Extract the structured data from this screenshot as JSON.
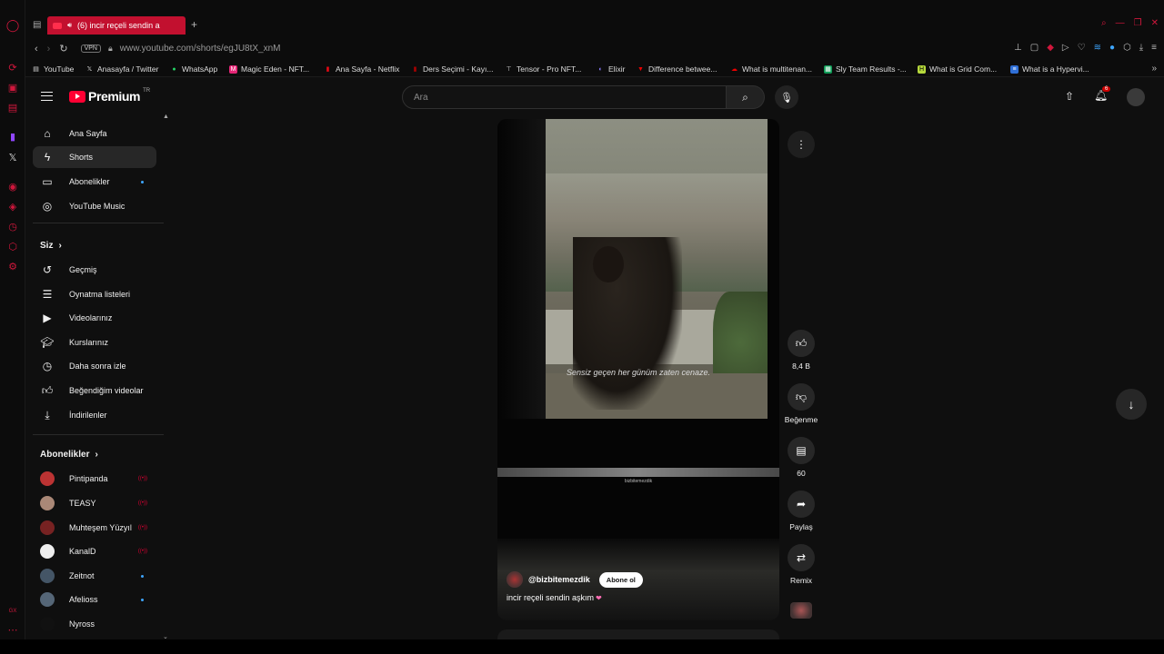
{
  "browser": {
    "tab_title": "(6) incir reçeli sendin a",
    "url": "www.youtube.com/shorts/egJU8tX_xnM",
    "vpn_label": "VPN",
    "bookmarks": [
      {
        "label": "YouTube",
        "icon": "page-icon"
      },
      {
        "label": "Anasayfa / Twitter",
        "icon": "x-icon"
      },
      {
        "label": "WhatsApp",
        "icon": "whatsapp-icon"
      },
      {
        "label": "Magic Eden - NFT...",
        "icon": "magic-eden-icon"
      },
      {
        "label": "Ana Sayfa - Netflix",
        "icon": "netflix-icon"
      },
      {
        "label": "Ders Seçimi - Kayı...",
        "icon": "school-icon"
      },
      {
        "label": "Tensor - Pro NFT...",
        "icon": "tensor-icon"
      },
      {
        "label": "Elixir",
        "icon": "elixir-icon"
      },
      {
        "label": "Difference betwee...",
        "icon": "vee-icon"
      },
      {
        "label": "What is multitenan...",
        "icon": "cloud-icon"
      },
      {
        "label": "Sly Team Results -...",
        "icon": "sheets-icon"
      },
      {
        "label": "What is Grid Com...",
        "icon": "h-icon"
      },
      {
        "label": "What is a Hypervi...",
        "icon": "ibm-icon"
      }
    ],
    "bell_count": "6",
    "colors": {
      "accent": "#d0173c",
      "tab": "#c2102f",
      "link": "#3ea6ff"
    }
  },
  "header": {
    "logo_text": "Premium",
    "logo_region": "TR",
    "search_placeholder": "Ara"
  },
  "sidebar": {
    "main": [
      {
        "label": "Ana Sayfa",
        "icon": "home-icon"
      },
      {
        "label": "Shorts",
        "icon": "shorts-icon",
        "active": true
      },
      {
        "label": "Abonelikler",
        "icon": "subscriptions-icon",
        "dot": true
      },
      {
        "label": "YouTube Music",
        "icon": "music-icon"
      }
    ],
    "you_title": "Siz",
    "you": [
      {
        "label": "Geçmiş",
        "icon": "history-icon"
      },
      {
        "label": "Oynatma listeleri",
        "icon": "playlist-icon"
      },
      {
        "label": "Videolarınız",
        "icon": "your-videos-icon"
      },
      {
        "label": "Kurslarınız",
        "icon": "courses-icon"
      },
      {
        "label": "Daha sonra izle",
        "icon": "watch-later-icon"
      },
      {
        "label": "Beğendiğim videolar",
        "icon": "liked-icon"
      },
      {
        "label": "İndirilenler",
        "icon": "download-icon"
      }
    ],
    "subs_title": "Abonelikler",
    "subs": [
      {
        "label": "Pintipanda",
        "live": true,
        "color": "#b33"
      },
      {
        "label": "TEASY",
        "live": true,
        "color": "#a87"
      },
      {
        "label": "Muhteşem Yüzyıl",
        "live": true,
        "color": "#722"
      },
      {
        "label": "KanalD",
        "live": true,
        "color": "#eee"
      },
      {
        "label": "Zeitnot",
        "dot": true,
        "color": "#456"
      },
      {
        "label": "Afelioss",
        "dot": true,
        "color": "#567"
      },
      {
        "label": "Nyross",
        "color": "#111"
      }
    ]
  },
  "short": {
    "subtitle": "Sensiz geçen her günüm zaten cenaze.",
    "watermark": "bizbitemezdik",
    "channel": "@bizbitemezdik",
    "subscribe_label": "Abone ol",
    "caption": "incir reçeli sendin aşkım",
    "caption_emoji": "❤"
  },
  "actions": {
    "likes": "8,4 B",
    "dislike_label": "Beğenme",
    "comments": "60",
    "share_label": "Paylaş",
    "remix_label": "Remix"
  }
}
